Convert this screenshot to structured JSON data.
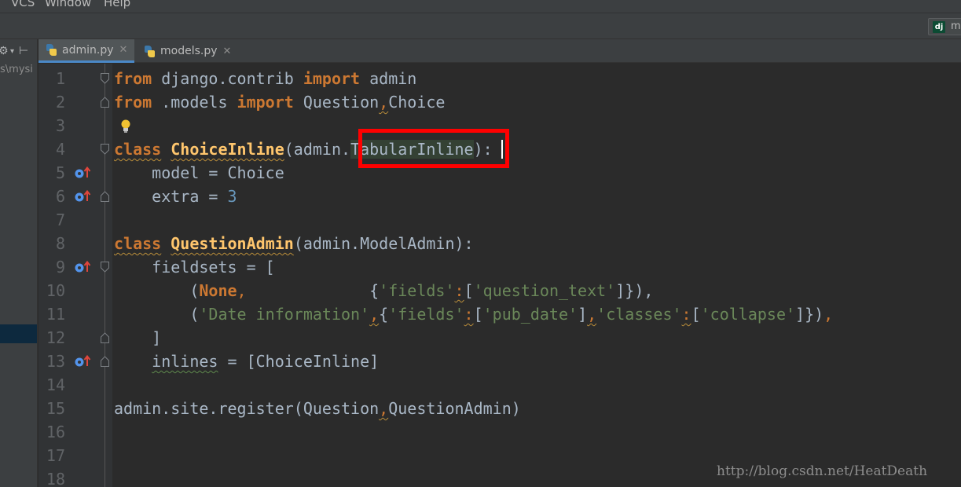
{
  "menubar": {
    "items": [
      "VCS",
      "Window",
      "Help"
    ]
  },
  "nav": {
    "chip_icon": "dj",
    "chip_label": "m"
  },
  "sidebar": {
    "tool_icons": [
      "gear-icon",
      "collapse-icon"
    ],
    "path_text": "s\\mysi"
  },
  "tabs": [
    {
      "label": "admin.py",
      "icon": "python-file-icon",
      "active": true
    },
    {
      "label": "models.py",
      "icon": "python-file-icon",
      "active": false
    }
  ],
  "editor": {
    "line_numbers": [
      "1",
      "2",
      "3",
      "4",
      "5",
      "6",
      "7",
      "8",
      "9",
      "10",
      "11",
      "12",
      "13",
      "14",
      "15",
      "16",
      "17",
      "18"
    ],
    "code": {
      "l1": {
        "kw1": "from",
        "t1": " django.contrib ",
        "kw2": "import",
        "t2": " admin"
      },
      "l2": {
        "kw1": "from",
        "t1": " .models ",
        "kw2": "import",
        "t2": " Question",
        "comma": ",",
        "t3": "Choice"
      },
      "l4": {
        "kw": "class",
        "name": "ChoiceInline",
        "t1": "(admin",
        "dot": ".",
        "base": "TabularInline",
        "t2": "):"
      },
      "l5": {
        "t1": "    model = Choice"
      },
      "l6": {
        "t1": "    extra = ",
        "num": "3"
      },
      "l8": {
        "kw": "class",
        "name": "QuestionAdmin",
        "t1": "(admin.ModelAdmin):"
      },
      "l9": {
        "t1": "    fieldsets = ["
      },
      "l10": {
        "t1": "        (",
        "kw": "None",
        "comma": ",",
        "pad": "             ",
        "t2": "{",
        "s1": "'fields'",
        "colon": ":",
        "t3": "[",
        "s2": "'question_text'",
        "t4": "]}",
        "t5": "),"
      },
      "l11": {
        "t1": "        (",
        "s1": "'Date information'",
        "c1": ",",
        "t2": "{",
        "s2": "'fields'",
        "colon1": ":",
        "t3": "[",
        "s3": "'pub_date'",
        "t4": "]",
        "c2": ",",
        "s4": "'classes'",
        "colon2": ":",
        "t5": "[",
        "s5": "'collapse'",
        "t6": "]})",
        "c3": ","
      },
      "l12": {
        "t1": "    ]"
      },
      "l13": {
        "t1": "    ",
        "w": "inlines",
        "t2": " = [ChoiceInline]"
      },
      "l15": {
        "t1": "admin.site.register(Question",
        "comma": ",",
        "t2": "QuestionAdmin)"
      }
    }
  },
  "watermark": "http://blog.csdn.net/HeatDeath",
  "colors": {
    "keyword": "#CC7832",
    "class_name": "#FFC66D",
    "string": "#6A8759",
    "number": "#6897BB",
    "text": "#A9B7C6",
    "annotation_box": "#FF0000"
  }
}
